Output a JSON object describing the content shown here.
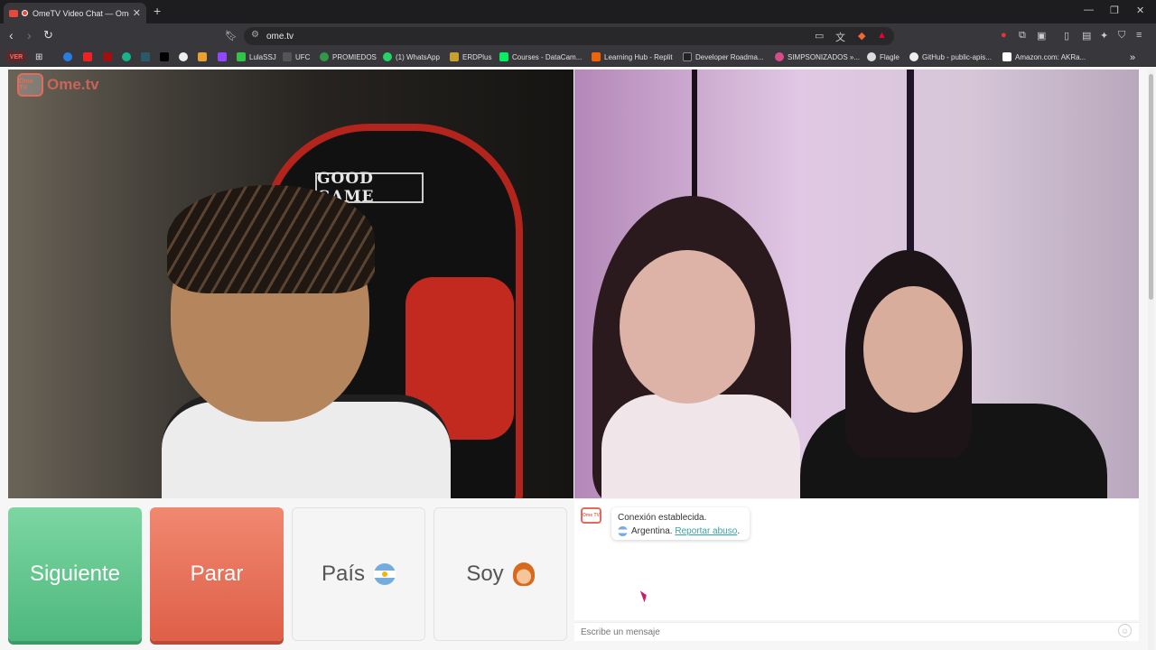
{
  "browser": {
    "tab_title": "OmeTV Video Chat — Omeg",
    "url": "ome.tv",
    "version_badge": "VER",
    "bookmarks": [
      {
        "label": "LulaSSJ",
        "color": "#35c24a"
      },
      {
        "label": "UFC",
        "color": "#555555"
      },
      {
        "label": "PROMIEDOS",
        "color": "#2e9a46"
      },
      {
        "label": "(1) WhatsApp",
        "color": "#25d366"
      },
      {
        "label": "ERDPlus",
        "color": "#c8a030"
      },
      {
        "label": "Courses - DataCam...",
        "color": "#03ef62"
      },
      {
        "label": "Learning Hub - Replit",
        "color": "#f26207"
      },
      {
        "label": "Developer Roadma...",
        "color": "#222222"
      },
      {
        "label": "SIMPSONIZADOS »...",
        "color": "#d84a8a"
      },
      {
        "label": "Flagle",
        "color": "#dddddd"
      },
      {
        "label": "GitHub - public-apis...",
        "color": "#eeeeee"
      },
      {
        "label": "Amazon.com: AKRa...",
        "color": "#ffffff"
      }
    ]
  },
  "logo": {
    "text": "Ome.tv",
    "badge": "Ome TV"
  },
  "video_left": {
    "caption": "GOOD GAME"
  },
  "controls": {
    "next_label": "Siguiente",
    "stop_label": "Parar",
    "country_label": "País",
    "gender_label": "Soy"
  },
  "chat": {
    "status": "Conexión establecida.",
    "country": "Argentina.",
    "report_link": "Reportar abuso",
    "report_suffix": ".",
    "input_placeholder": "Escribe un mensaje"
  },
  "colors": {
    "next": "#5cc68c",
    "stop": "#e86d55",
    "brand": "#e56a5b"
  }
}
